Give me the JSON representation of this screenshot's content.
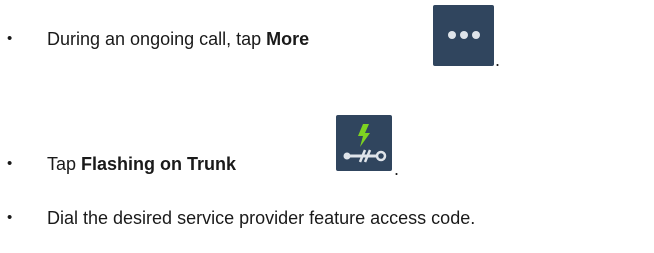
{
  "steps": [
    {
      "bullet": "•",
      "text_before": "During an ongoing call, tap ",
      "bold": "More",
      "icon": "more-icon",
      "text_after": "."
    },
    {
      "bullet": "•",
      "text_before": "Tap ",
      "bold": "Flashing on Trunk",
      "icon": "flashing-on-trunk-icon",
      "text_after": "."
    },
    {
      "bullet": "•",
      "text_before": "Dial the desired service provider feature access code.",
      "bold": "",
      "icon": "",
      "text_after": ""
    }
  ],
  "colors": {
    "icon_background": "#30455e",
    "icon_foreground": "#dfe4ea",
    "flash_green": "#7ed321",
    "text": "#1a1a1a"
  }
}
